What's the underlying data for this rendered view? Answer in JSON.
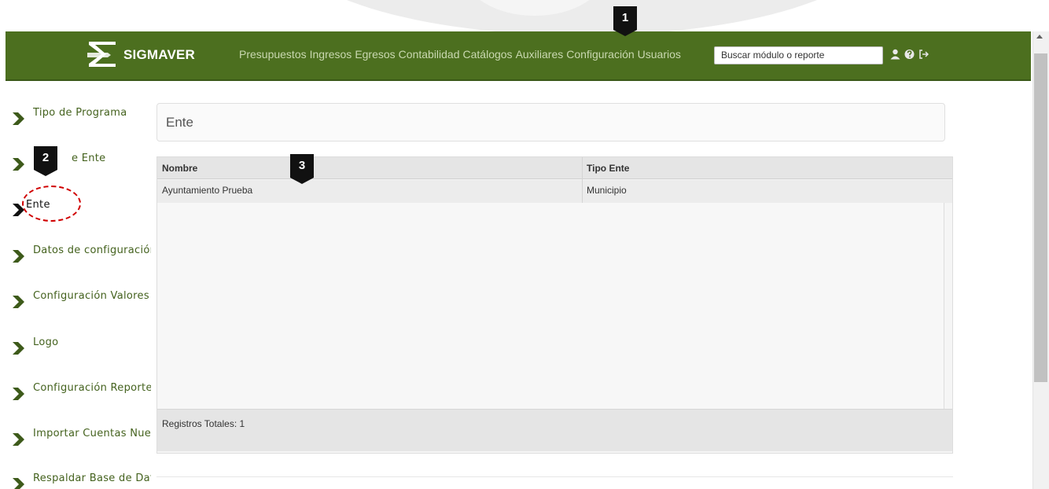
{
  "header": {
    "brand_name": "SIGMAVER",
    "nav": [
      "Presupuestos",
      "Ingresos",
      "Egresos",
      "Contabilidad",
      "Catálogos",
      "Auxiliares",
      "Configuración",
      "Usuarios"
    ],
    "search_placeholder": "Buscar módulo o reporte",
    "icons": [
      "user-icon",
      "help-icon",
      "logout-icon"
    ],
    "bg_color": "#4c6f1f"
  },
  "sidebar": {
    "items": [
      {
        "label": "Tipo de Programa"
      },
      {
        "label": "e Ente"
      },
      {
        "label": "Ente",
        "active": true
      },
      {
        "label": "Datos de configuración"
      },
      {
        "label": "Configuración Valores"
      },
      {
        "label": "Logo"
      },
      {
        "label": "Configuración Reportes"
      },
      {
        "label": "Importar Cuentas Nueva"
      },
      {
        "label": "Respaldar Base de Datc"
      }
    ],
    "chevron_color": "#3d5a1a"
  },
  "main": {
    "title": "Ente",
    "table": {
      "columns": [
        "Nombre",
        "Tipo Ente"
      ],
      "rows": [
        [
          "Ayuntamiento Prueba",
          "Municipio"
        ]
      ],
      "footer": "Registros Totales: 1"
    }
  },
  "callouts": [
    "1",
    "2",
    "3"
  ],
  "highlight_color": "#d00000"
}
